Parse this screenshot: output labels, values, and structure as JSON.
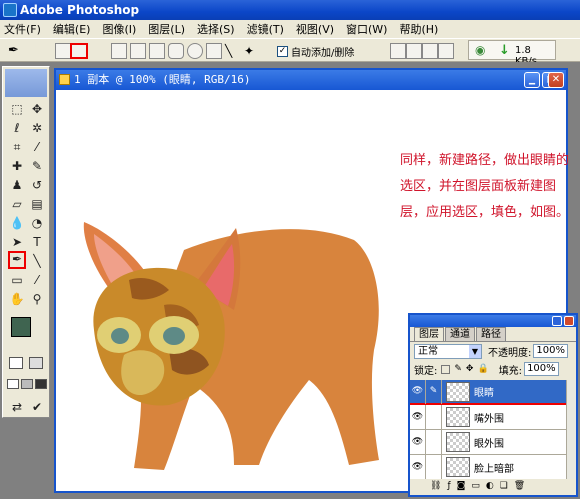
{
  "app": {
    "title": "Adobe Photoshop"
  },
  "menu": [
    "文件(F)",
    "编辑(E)",
    "图像(I)",
    "图层(L)",
    "选择(S)",
    "滤镜(T)",
    "视图(V)",
    "窗口(W)",
    "帮助(H)"
  ],
  "options": {
    "auto_add_delete_label": "自动添加/删除",
    "auto_add_delete_checked": true,
    "speed": "1.8 KB/s"
  },
  "document": {
    "title": "1 副本 @ 100% (眼睛, RGB/16)"
  },
  "instruction": {
    "text": "同样，新建路径，做出眼睛的选区，并在图层面板新建图层，应用选区，填色，如图。"
  },
  "colors": {
    "foreground": "#3f6450",
    "background": "#e21a1a",
    "cat_body": "#d8843d",
    "annotation": "#d0142b"
  },
  "layers_panel": {
    "tabs": [
      "图层",
      "通道",
      "路径"
    ],
    "blend_mode": "正常",
    "opacity_label": "不透明度:",
    "opacity_value": "100%",
    "lock_label": "锁定:",
    "fill_label": "填充:",
    "fill_value": "100%",
    "layers": [
      {
        "name": "眼睛",
        "selected": true
      },
      {
        "name": "嘴外围",
        "selected": false
      },
      {
        "name": "眼外围",
        "selected": false
      },
      {
        "name": "脸上暗部",
        "selected": false
      }
    ]
  }
}
